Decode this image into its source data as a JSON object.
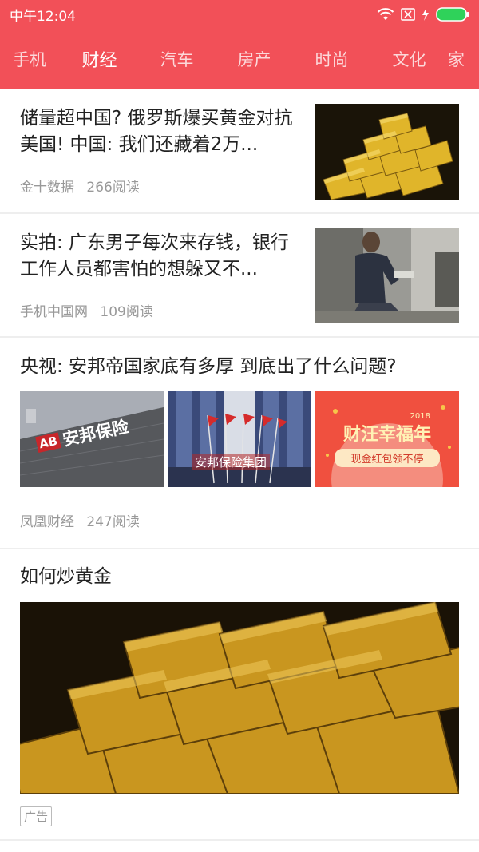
{
  "status_bar": {
    "time": "中午12:04",
    "icons": [
      "wifi-icon",
      "sim-off-icon",
      "charging-icon",
      "battery-icon"
    ]
  },
  "tabs": [
    {
      "label": "手机",
      "active": false
    },
    {
      "label": "财经",
      "active": true
    },
    {
      "label": "汽车",
      "active": false
    },
    {
      "label": "房产",
      "active": false
    },
    {
      "label": "时尚",
      "active": false
    },
    {
      "label": "文化",
      "active": false
    }
  ],
  "articles": [
    {
      "title": "储量超中国? 俄罗斯爆买黄金对抗美国! 中国: 我们还藏着2万...",
      "source": "金十数据",
      "reads": "266阅读"
    },
    {
      "title": "实拍: 广东男子每次来存钱，银行工作人员都害怕的想躲又不...",
      "source": "手机中国网",
      "reads": "109阅读"
    },
    {
      "title": "央视: 安邦帝国家底有多厚 到底出了什么问题?",
      "source": "凤凰财经",
      "reads": "247阅读",
      "image_texts": {
        "sign_logo": "AB",
        "sign_text": "安邦保险",
        "building_text": "安邦保险集团",
        "promo_title": "财汪幸福年",
        "promo_year": "2018",
        "promo_button": "现金红包领不停"
      }
    },
    {
      "title": "如何炒黄金",
      "ad_label": "广告"
    }
  ],
  "colors": {
    "brand": "#f25058",
    "battery": "#2fd25a"
  }
}
